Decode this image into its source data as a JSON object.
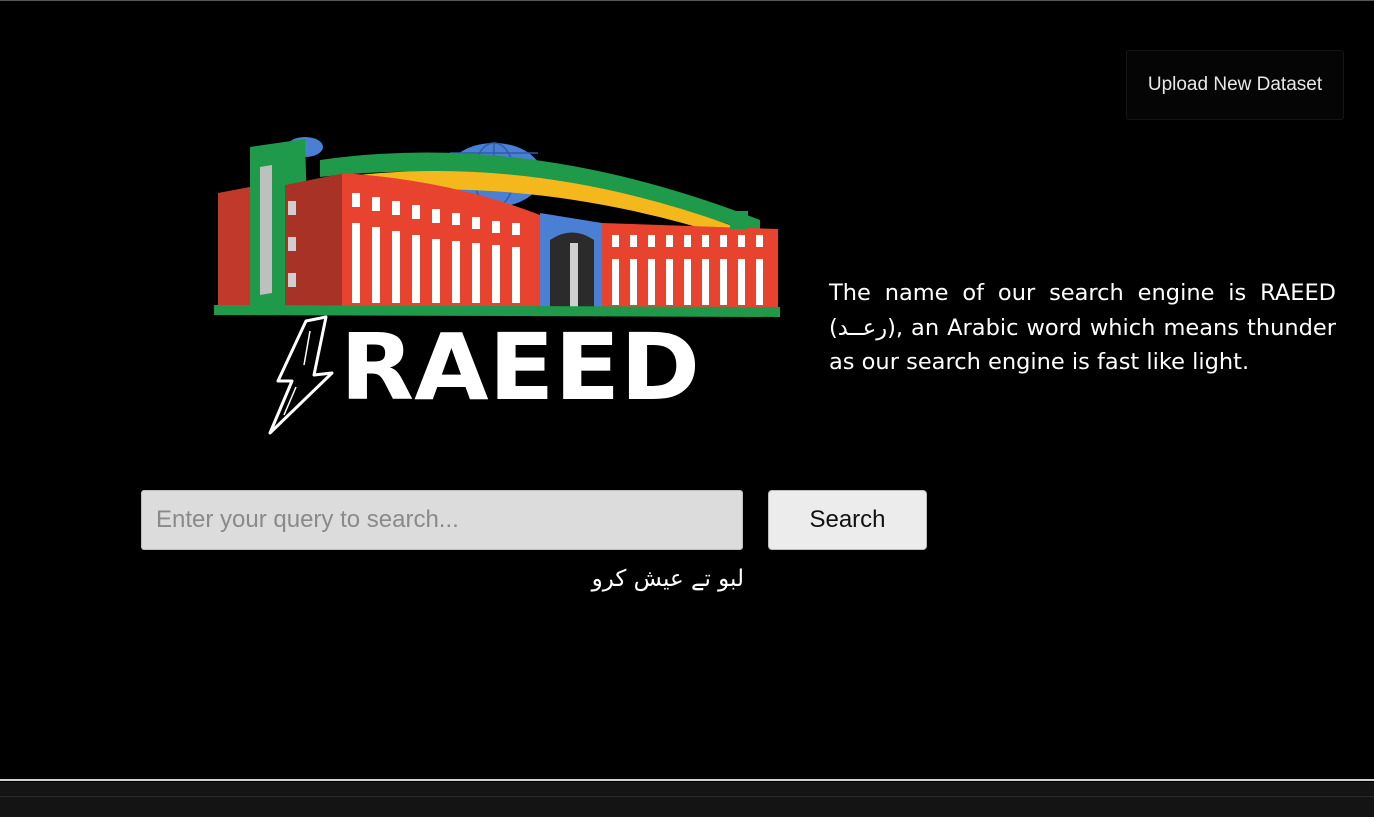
{
  "header": {
    "upload_button_label": "Upload New Dataset"
  },
  "logo": {
    "text": "RAEED",
    "icon": "lightning-bolt-icon",
    "building_icon": "building-icon"
  },
  "description": {
    "text": "The name of our search engine is RAEED (رعــد), an Arabic word which means thunder as our search engine is fast like light."
  },
  "search": {
    "placeholder": "Enter your query to search...",
    "value": "",
    "button_label": "Search"
  },
  "tagline": {
    "text": "لبو تے عیش کرو"
  },
  "colors": {
    "background": "#000000",
    "brand_red": "#e8432f",
    "brand_green": "#1f9a4a",
    "brand_yellow": "#f4b81c",
    "brand_blue": "#4a7fd4"
  }
}
